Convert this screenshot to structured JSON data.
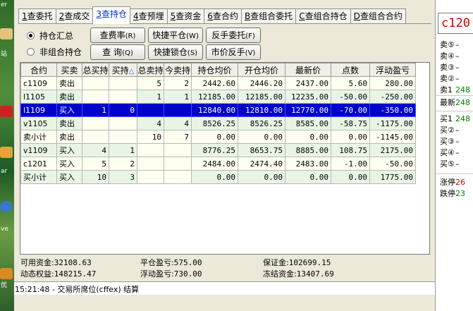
{
  "desktop": {
    "label_er": "er",
    "label_zhan": "站",
    "label_ar": "ar",
    "label_ve": "ve",
    "label_you": "优"
  },
  "tabs": [
    {
      "key": "1",
      "label": "查委托"
    },
    {
      "key": "2",
      "label": "查成交"
    },
    {
      "key": "3",
      "label": "查持仓",
      "active": true
    },
    {
      "key": "4",
      "label": "查预埋"
    },
    {
      "key": "5",
      "label": "查资金"
    },
    {
      "key": "6",
      "label": "查合约"
    },
    {
      "key": "B",
      "label": "查组合委托"
    },
    {
      "key": "C",
      "label": "查组合持仓"
    },
    {
      "key": "D",
      "label": "查组合合约"
    }
  ],
  "radios": {
    "summary": "持仓汇总",
    "non_combo": "非组合持仓"
  },
  "buttons": {
    "fee_rate": {
      "label": "查费率",
      "key": "(R)"
    },
    "query": {
      "label": "查 询",
      "key": "(Q)"
    },
    "quick_close": {
      "label": "快捷平仓",
      "key": "(W)"
    },
    "quick_lock": {
      "label": "快捷锁仓",
      "key": "(S)"
    },
    "reverse_order": {
      "label": "反手委托",
      "key": "(F)"
    },
    "market_reverse": {
      "label": "市价反手",
      "key": "(V)"
    }
  },
  "table": {
    "headers": [
      "合约",
      "买卖",
      "总买持",
      "买持",
      "总卖持",
      "今卖持",
      "持仓均价",
      "开仓均价",
      "最新价",
      "点数",
      "浮动盈亏"
    ],
    "sort_indicator": "△",
    "rows": [
      [
        "c1109",
        "卖出",
        "",
        "",
        "5",
        "2",
        "2442.60",
        "2446.20",
        "2437.00",
        "5.60",
        "280.00"
      ],
      [
        "l1105",
        "卖出",
        "",
        "",
        "1",
        "1",
        "12185.00",
        "12185.00",
        "12235.00",
        "-50.00",
        "-250.00"
      ],
      [
        "l1109",
        "买入",
        "1",
        "0",
        "",
        "",
        "12840.00",
        "12810.00",
        "12770.00",
        "-70.00",
        "-350.00"
      ],
      [
        "v1105",
        "卖出",
        "",
        "",
        "4",
        "4",
        "8526.25",
        "8526.25",
        "8585.00",
        "-58.75",
        "-1175.00"
      ],
      [
        "卖小计",
        "卖出",
        "",
        "",
        "10",
        "7",
        "0.00",
        "0.00",
        "0.00",
        "0.00",
        "-1145.00"
      ],
      [
        "v1109",
        "买入",
        "4",
        "1",
        "",
        "",
        "8776.25",
        "8653.75",
        "8885.00",
        "108.75",
        "2175.00"
      ],
      [
        "c1201",
        "买入",
        "5",
        "2",
        "",
        "",
        "2484.00",
        "2474.40",
        "2483.00",
        "-1.00",
        "-50.00"
      ],
      [
        "买小计",
        "买入",
        "10",
        "3",
        "",
        "",
        "0.00",
        "0.00",
        "0.00",
        "0.00",
        "1775.00"
      ]
    ],
    "selected_row": 2
  },
  "summary": {
    "available_funds_label": "可用资金:",
    "available_funds": "32108.63",
    "close_pnl_label": "平仓盈亏:",
    "close_pnl": "575.00",
    "margin_label": "保证金:",
    "margin": "102699.15",
    "dynamic_equity_label": "动态权益:",
    "dynamic_equity": "148215.47",
    "float_pnl_label": "浮动盈亏:",
    "float_pnl": "730.00",
    "frozen_funds_label": "冻结资金:",
    "frozen_funds": "13407.69"
  },
  "log": {
    "text": "15:21:48 - 交易所席位(cffex) 结算"
  },
  "quote": {
    "title": "c120",
    "asks": [
      {
        "label": "卖⑤",
        "value": "–"
      },
      {
        "label": "卖④",
        "value": "–"
      },
      {
        "label": "卖③",
        "value": "–"
      },
      {
        "label": "卖②",
        "value": "–"
      },
      {
        "label": "卖1",
        "value": "248"
      }
    ],
    "latest_label": "最新",
    "latest": "248",
    "bids": [
      {
        "label": "买1",
        "value": "248"
      },
      {
        "label": "买②",
        "value": "–"
      },
      {
        "label": "买③",
        "value": "–"
      },
      {
        "label": "买④",
        "value": "–"
      },
      {
        "label": "买⑤",
        "value": "–"
      }
    ],
    "limit_up_label": "涨停",
    "limit_up": "26",
    "limit_down_label": "跌停",
    "limit_down": "23"
  },
  "colors": {
    "selected_row": "#0000cc",
    "positive": "#008000",
    "negative": "#d40000",
    "active_tab": "#0033cc"
  }
}
